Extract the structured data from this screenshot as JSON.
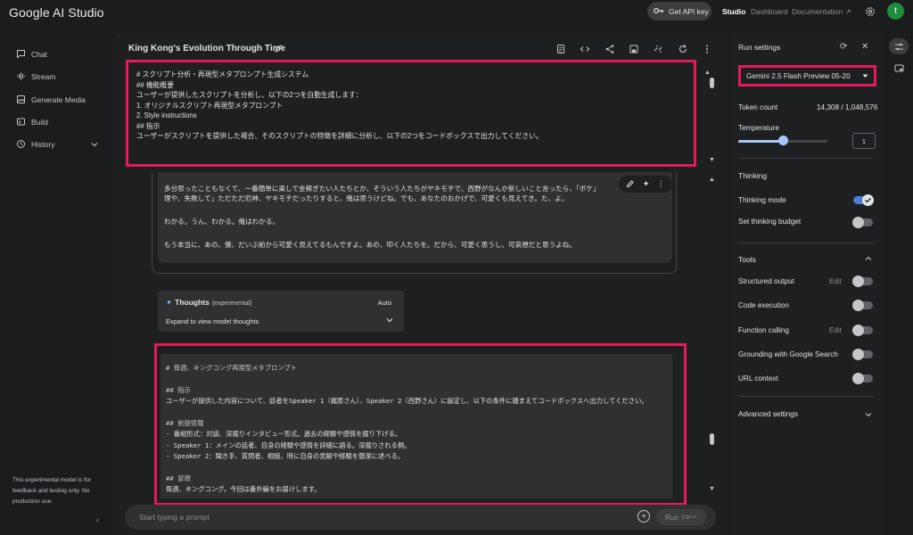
{
  "app": {
    "title": "Google AI Studio",
    "get_api_key": "Get API key",
    "nav": [
      "Studio",
      "Dashboard",
      "Documentation"
    ],
    "avatar_initial": "t"
  },
  "sidebar": {
    "items": [
      {
        "label": "Chat",
        "icon": "chat-icon"
      },
      {
        "label": "Stream",
        "icon": "waveform-icon"
      },
      {
        "label": "Generate Media",
        "icon": "media-icon"
      },
      {
        "label": "Build",
        "icon": "build-icon"
      },
      {
        "label": "History",
        "icon": "history-icon"
      }
    ],
    "note": "This experimental model is for feedback and testing only. No production use."
  },
  "main": {
    "title": "King Kong's Evolution Through Time",
    "system_prompt": [
      "# スクリプト分析・再現型メタプロンプト生成システム",
      "",
      "## 機能概要",
      "ユーザーが提供したスクリプトを分析し、以下の2つを自動生成します：",
      "1. オリジナルスクリプト再現型メタプロンプト",
      "2. Style instructions",
      "",
      "## 指示",
      "ユーザーがスクリプトを提供した場合、そのスクリプトの特徴を詳細に分析し、以下の2つをコードボックスで出力してください。"
    ],
    "transcript": [
      "多分思ったこともなくて、一番簡単に楽して金稼ぎたい人たちとか、そういう人たちがヤキモチで、西野がなんか新しいこと言ったら、「ボケ」",
      "理や、失敗して」ただただ厄神、ヤキモチだったりすると、俺は思うけどね。でも、あなたのおかげで、可愛くも見えてき。た、よ。",
      "わかる。うん、わかる。俺はわかる。",
      "もう本当に、あの、僕、だいぶ前から可愛く見えてるもんですよ。あの、叩く人たちを。だから、可愛く思うし、可哀想だと思うよね。"
    ],
    "thoughts": {
      "title": "Thoughts",
      "badge": "(experimental)",
      "mode": "Auto",
      "expand": "Expand to view model thoughts"
    },
    "answer_lines": [
      "# 毎週、キングコング再現型メタプロンプト",
      "",
      "## 指示",
      "ユーザーが提供した内容について、話者をSpeaker 1（梶原さん）、Speaker 2（西野さん）に設定し、以下の条件に踏まえてコードボックスへ出力してください。",
      "",
      "## 前提情報",
      "- 番組形式：対談、深掘りインタビュー形式。過去の経験や感情を掘り下げる。",
      "- Speaker 1：メインの話者、自身の経験や感情を詳細に語る。深掘りされる側。",
      "- Speaker 2：聞き手、質問者、相槌、時に自身の見解や経験を簡潔に述べる。",
      "",
      "## 冒頭",
      "毎週、キングコング。今回は番外編をお届けします。"
    ],
    "input_placeholder": "Start typing a prompt",
    "run_label": "Run",
    "run_shortcut": "Ctrl ↵"
  },
  "run_settings": {
    "title": "Run settings",
    "model": "Gemini 2.5 Flash Preview 05-20",
    "token_count_label": "Token count",
    "token_count_value": "14,308 / 1,048,576",
    "temperature_label": "Temperature",
    "temperature_value": "1",
    "temperature_fraction": 0.5,
    "thinking_title": "Thinking",
    "thinking_mode_label": "Thinking mode",
    "thinking_mode_on": true,
    "thinking_budget_label": "Set thinking budget",
    "tools_title": "Tools",
    "structured_output_label": "Structured output",
    "code_execution_label": "Code execution",
    "function_calling_label": "Function calling",
    "grounding_label": "Grounding with Google Search",
    "url_context_label": "URL context",
    "edit_label": "Edit",
    "advanced_settings_label": "Advanced settings"
  },
  "colors": {
    "highlight": "#e6195c",
    "accent": "#a8c7fa",
    "avatar": "#1e8e3e"
  }
}
